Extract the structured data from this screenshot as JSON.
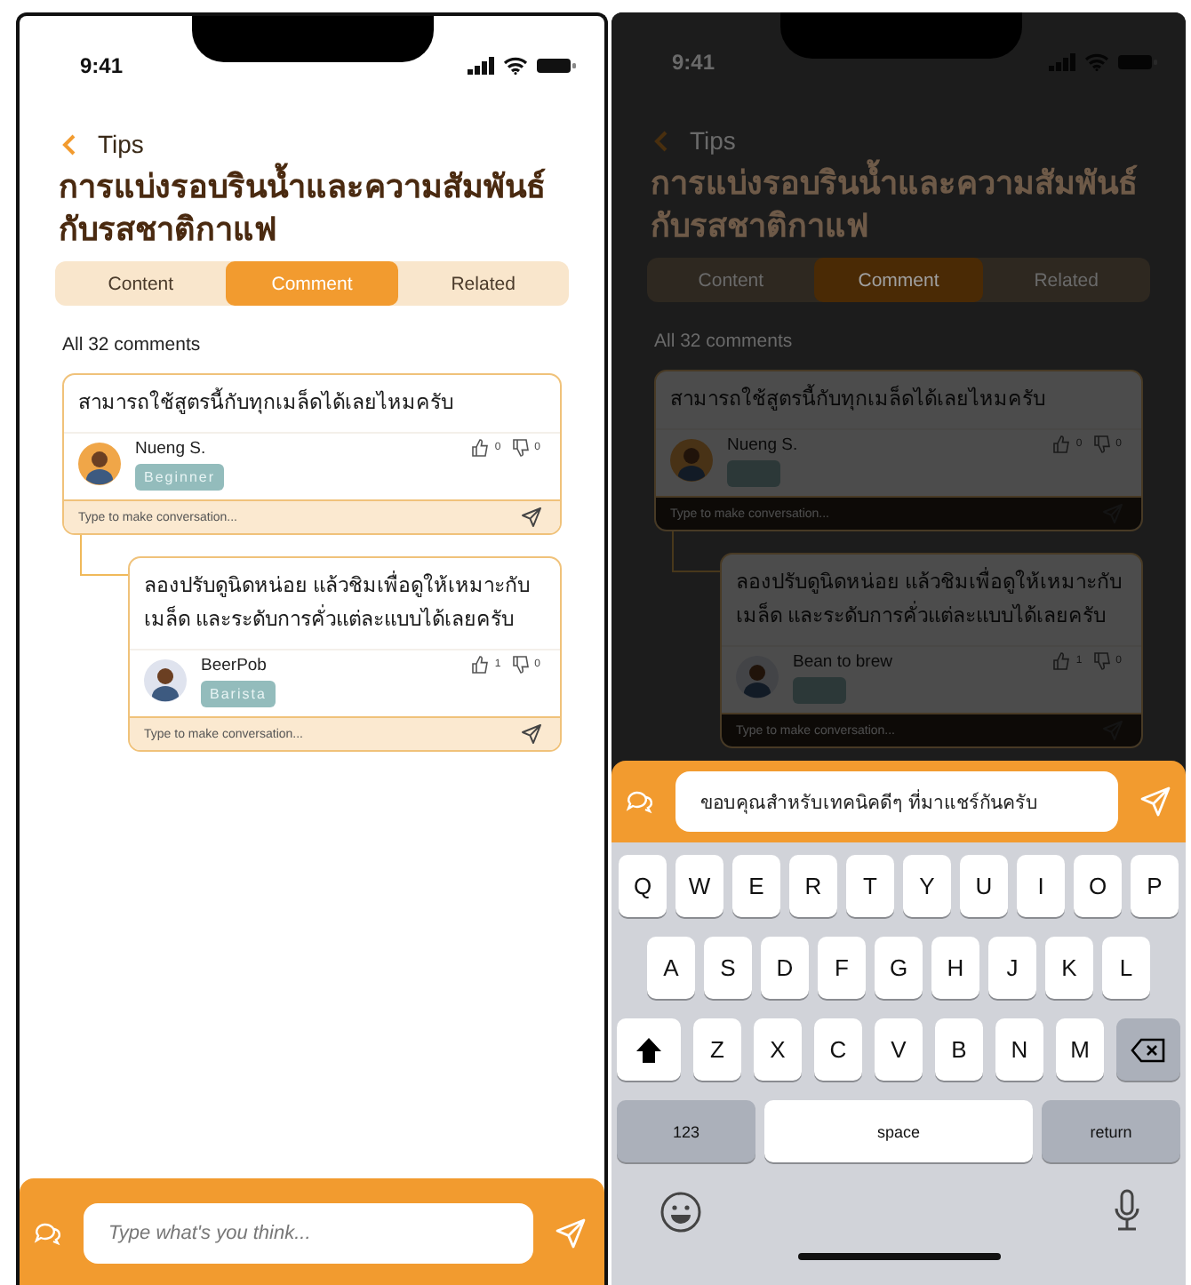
{
  "screens": [
    {
      "dimmed": false,
      "status_bar": {
        "time": "9:41"
      },
      "header": {
        "back_label": "Tips",
        "title": "การแบ่งรอบรินน้ำและความสัมพันธ์กับรสชาติกาแฟ"
      },
      "tabs": [
        {
          "label": "Content",
          "selected": false
        },
        {
          "label": "Comment",
          "selected": true
        },
        {
          "label": "Related",
          "selected": false
        }
      ],
      "comment_count": "All 32 comments",
      "comments": [
        {
          "text": "สามารถใช้สูตรนี้กับทุกเมล็ดได้เลยไหมครับ",
          "author": "Nueng S.",
          "badge": "Beginner",
          "likes": "0",
          "dislikes": "0",
          "reply_placeholder": "Type to make conversation...",
          "children": [
            {
              "text": "ลองปรับดูนิดหน่อย แล้วชิมเพื่อดูให้เหมาะกับเมล็ด และระดับการคั่วแต่ละแบบได้เลยครับ",
              "author": "BeerPob",
              "badge": "Barista",
              "likes": "1",
              "dislikes": "0",
              "reply_placeholder": "Type to make conversation..."
            }
          ]
        }
      ],
      "composer": {
        "placeholder": "Type what's you think..."
      }
    },
    {
      "dimmed": true,
      "status_bar": {
        "time": "9:41"
      },
      "header": {
        "back_label": "Tips",
        "title": "การแบ่งรอบรินน้ำและความสัมพันธ์กับรสชาติกาแฟ"
      },
      "tabs": [
        {
          "label": "Content",
          "selected": false
        },
        {
          "label": "Comment",
          "selected": true
        },
        {
          "label": "Related",
          "selected": false
        }
      ],
      "comment_count": "All 32 comments",
      "comments": [
        {
          "text": "สามารถใช้สูตรนี้กับทุกเมล็ดได้เลยไหมครับ",
          "author": "Nueng S.",
          "likes": "0",
          "dislikes": "0",
          "reply_placeholder": "Type to make conversation...",
          "children": [
            {
              "text": "ลองปรับดูนิดหน่อย แล้วชิมเพื่อดูให้เหมาะกับเมล็ด และระดับการคั่วแต่ละแบบได้เลยครับ",
              "author": "Bean to brew",
              "likes": "1",
              "dislikes": "0",
              "reply_placeholder": "Type to make conversation..."
            }
          ]
        }
      ],
      "composer": {
        "value": "ขอบคุณสำหรับเทคนิคดีๆ ที่มาแชร์กันครับ"
      },
      "keyboard": {
        "rows": [
          {
            "keys": [
              {
                "kind": "letter",
                "label": "Q"
              },
              {
                "kind": "letter",
                "label": "W"
              },
              {
                "kind": "letter",
                "label": "E"
              },
              {
                "kind": "letter",
                "label": "R"
              },
              {
                "kind": "letter",
                "label": "T"
              },
              {
                "kind": "letter",
                "label": "Y"
              },
              {
                "kind": "letter",
                "label": "U"
              },
              {
                "kind": "letter",
                "label": "I"
              },
              {
                "kind": "letter",
                "label": "O"
              },
              {
                "kind": "letter",
                "label": "P"
              }
            ]
          },
          {
            "keys": [
              {
                "kind": "letter",
                "label": "A"
              },
              {
                "kind": "letter",
                "label": "S"
              },
              {
                "kind": "letter",
                "label": "D"
              },
              {
                "kind": "letter",
                "label": "F"
              },
              {
                "kind": "letter",
                "label": "G"
              },
              {
                "kind": "letter",
                "label": "H"
              },
              {
                "kind": "letter",
                "label": "J"
              },
              {
                "kind": "letter",
                "label": "K"
              },
              {
                "kind": "letter",
                "label": "L"
              }
            ]
          },
          {
            "keys": [
              {
                "kind": "shift"
              },
              {
                "kind": "letter",
                "label": "Z"
              },
              {
                "kind": "letter",
                "label": "X"
              },
              {
                "kind": "letter",
                "label": "C"
              },
              {
                "kind": "letter",
                "label": "V"
              },
              {
                "kind": "letter",
                "label": "B"
              },
              {
                "kind": "letter",
                "label": "N"
              },
              {
                "kind": "letter",
                "label": "M"
              },
              {
                "kind": "backspace"
              }
            ]
          },
          {
            "keys": [
              {
                "kind": "mode",
                "label": "123"
              },
              {
                "kind": "space",
                "label": "space"
              },
              {
                "kind": "return",
                "label": "return"
              }
            ]
          }
        ]
      }
    }
  ]
}
